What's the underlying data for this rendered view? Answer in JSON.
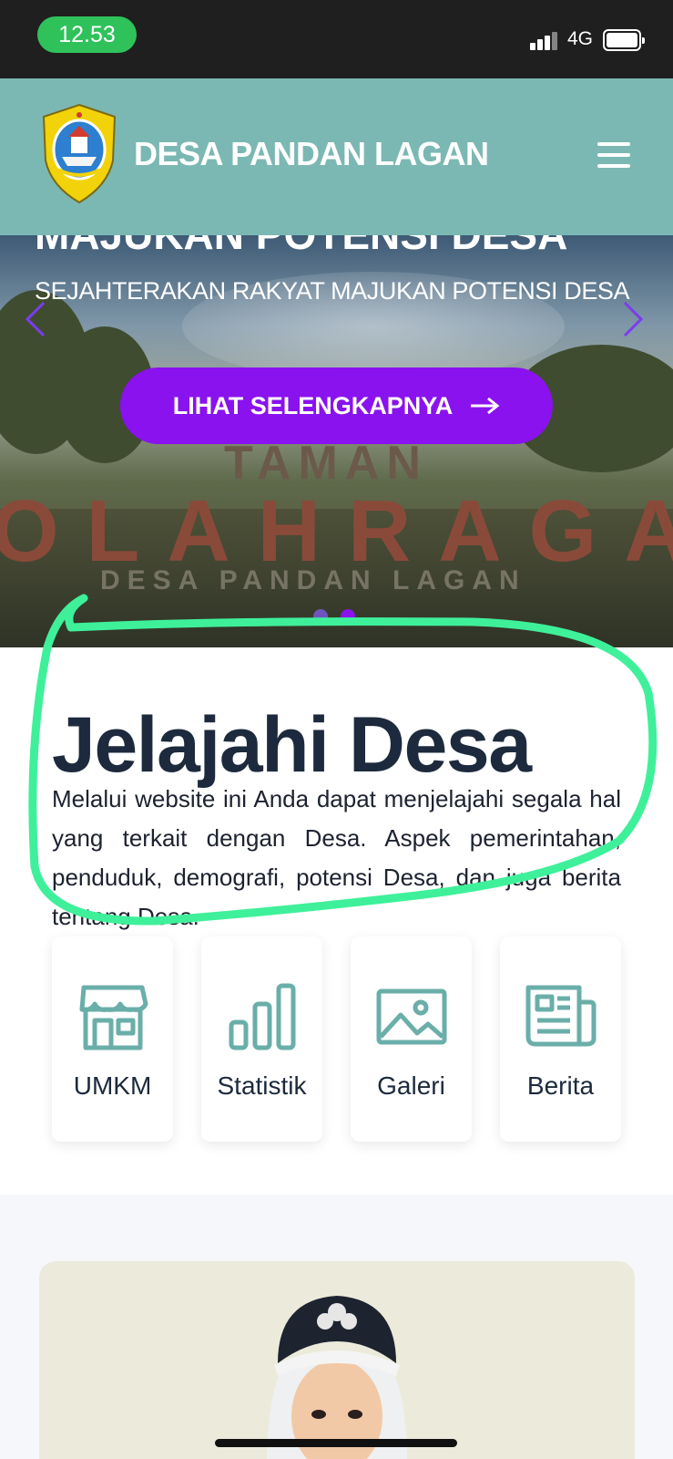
{
  "status_bar": {
    "time": "12.53",
    "network": "4G"
  },
  "header": {
    "title": "DESA PANDAN LAGAN"
  },
  "hero": {
    "heading": "MAJUKAN POTENSI DESA",
    "subtitle": "SEJAHTERAKAN RAKYAT MAJUKAN POTENSI DESA",
    "cta_label": "LIHAT SELENGKAPNYA",
    "photo_text": {
      "line1": "TAMAN",
      "line2": "OLAHRAGA",
      "line3": "DESA PANDAN LAGAN"
    },
    "accent_color": "#8a12ee"
  },
  "intro": {
    "title": "Jelajahi Desa",
    "text": "Melalui website ini Anda dapat menjelajahi segala hal yang terkait dengan Desa. Aspek pemerintahan, penduduk, demografi, potensi Desa, dan juga berita tentang Desa."
  },
  "features": [
    {
      "label": "UMKM",
      "icon": "store-icon"
    },
    {
      "label": "Statistik",
      "icon": "bar-chart-icon"
    },
    {
      "label": "Galeri",
      "icon": "image-icon"
    },
    {
      "label": "Berita",
      "icon": "newspaper-icon"
    }
  ],
  "colors": {
    "header": "#7cb8b3",
    "icon": "#6aaea9",
    "annotation": "#3ff09a",
    "text_dark": "#1d2a3d"
  }
}
